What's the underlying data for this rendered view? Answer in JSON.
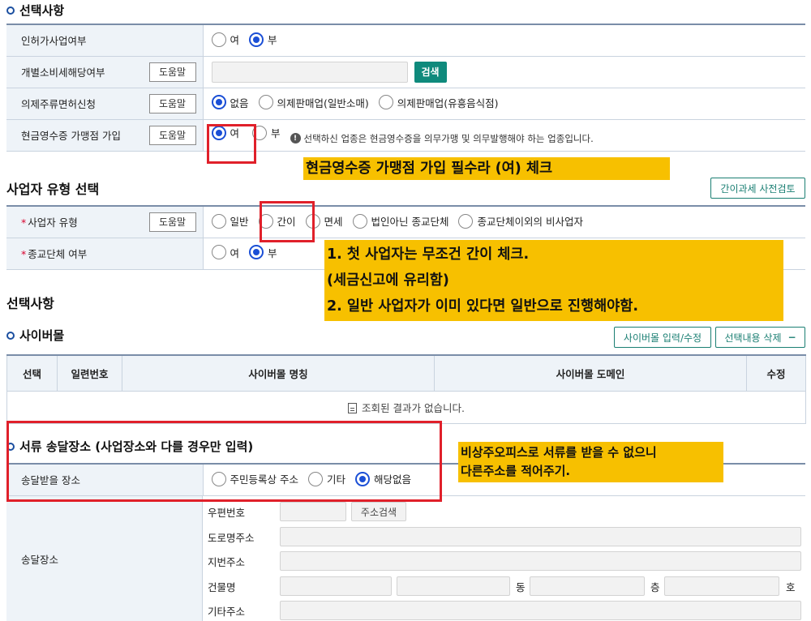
{
  "section1": {
    "title": "선택사항",
    "rows": [
      {
        "label": "인허가사업여부",
        "options": [
          "여",
          "부"
        ],
        "selected": 1
      },
      {
        "label": "개별소비세해당여부",
        "help": "도움말",
        "search_label": "검색"
      },
      {
        "label": "의제주류면허신청",
        "help": "도움말",
        "options": [
          "없음",
          "의제판매업(일반소매)",
          "의제판매업(유흥음식점)"
        ],
        "selected": 0
      },
      {
        "label": "현금영수증 가맹점 가입",
        "help": "도움말",
        "options": [
          "여",
          "부"
        ],
        "selected": 0,
        "info": "선택하신 업종은 현금영수증을 의무가맹 및 의무발행해야 하는 업종입니다."
      }
    ]
  },
  "section2": {
    "title": "사업자 유형 선택",
    "precheck_button": "간이과세 사전검토",
    "rows": [
      {
        "required": "*",
        "label": "사업자 유형",
        "help": "도움말",
        "options": [
          "일반",
          "간이",
          "면세",
          "법인아닌 종교단체",
          "종교단체이외의 비사업자"
        ],
        "selected": -1
      },
      {
        "required": "*",
        "label": "종교단체 여부",
        "options": [
          "여",
          "부"
        ],
        "selected": 1
      }
    ]
  },
  "section3": {
    "title": "선택사항",
    "cybermall": {
      "title": "사이버몰",
      "input_button": "사이버몰 입력/수정",
      "delete_button": "선택내용 삭제",
      "delete_icon": "−",
      "columns": [
        "선택",
        "일련번호",
        "사이버몰 명칭",
        "사이버몰 도메인",
        "수정"
      ],
      "empty_message": "조회된 결과가 없습니다."
    },
    "delivery": {
      "title": "서류 송달장소 (사업장소와 다를 경우만 입력)",
      "place_label": "송달받을 장소",
      "options": [
        "주민등록상 주소",
        "기타",
        "해당없음"
      ],
      "selected": 2,
      "address_label": "송달장소",
      "postcode": "우편번호",
      "address_search": "주소검색",
      "road": "도로명주소",
      "lot": "지번주소",
      "building": "건물명",
      "dong": "동",
      "floor": "층",
      "ho": "호",
      "other": "기타주소"
    }
  },
  "annotations": {
    "cash_receipt": "현금영수증 가맹점 가입 필수라 (여) 체크",
    "business_type": [
      "1. 첫 사업자는 무조건 간이 체크.",
      "(세금신고에 유리함)",
      "2. 일반 사업자가 이미 있다면 일반으로 진행해야함."
    ],
    "delivery": [
      "비상주오피스로 서류를 받을 수 없으니",
      "다른주소를 적어주기."
    ]
  },
  "colors": {
    "accent_teal": "#0f8a7c",
    "radio_blue": "#1b4fd6",
    "annotation_yellow": "#f7c000",
    "highlight_red": "#e0202a"
  }
}
